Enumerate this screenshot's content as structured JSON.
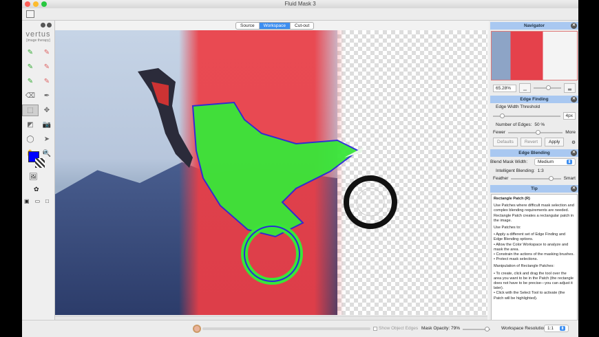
{
  "window": {
    "title": "Fluid Mask 3"
  },
  "logo": {
    "name": "vertus",
    "tagline": "[image therapy]"
  },
  "tabs": [
    {
      "label": "Source"
    },
    {
      "label": "Workspace",
      "active": true
    },
    {
      "label": "Cut-out"
    }
  ],
  "tools": [
    "brush-keep-icon",
    "brush-delete-icon",
    "brush-keep-medium-icon",
    "brush-delete-medium-icon",
    "brush-keep-large-icon",
    "brush-delete-large-icon",
    "eraser-icon",
    "pen-icon",
    "rectangle-patch-icon",
    "patch-local-icon",
    "color-picker-icon",
    "camera-icon",
    "lasso-icon",
    "select-arrow-icon",
    "hand-icon",
    "zoom-icon"
  ],
  "colors": {
    "foreground": "#0000ff",
    "accent": "#3d8ef0",
    "panel_header": "#a9c8f1",
    "mask_red": "#ec3e46",
    "edge_green": "#39e639",
    "edge_blue": "#2a2ad8"
  },
  "navigator": {
    "title": "Navigator",
    "zoom": "65.28%",
    "zoom_fraction": 0.45
  },
  "edge_finding": {
    "title": "Edge Finding",
    "threshold_label": "Edge Width Threshold",
    "threshold_value": "4px",
    "threshold_fraction": 0.1,
    "edges_label": "Number of Edges:",
    "edges_value": "50 %",
    "edges_fraction": 0.5,
    "fewer": "Fewer",
    "more": "More",
    "defaults": "Defaults",
    "revert": "Revert",
    "apply": "Apply"
  },
  "edge_blending": {
    "title": "Edge Blending",
    "mask_width_label": "Blend Mask Width:",
    "mask_width_value": "Medium",
    "intelligent_label": "Intelligent Blending:",
    "intelligent_value": "1:3",
    "feather": "Feather",
    "smart": "Smart",
    "blend_fraction": 0.75
  },
  "tip": {
    "title": "Tip",
    "heading": "Rectangle Patch (R)",
    "p1": "Use Patches where difficult mask selection and complex blending requirements are needed. Rectangle Patch creates a rectangular patch in the image.",
    "p2": "Use Patches to:",
    "b1": "• Apply a different set of Edge Finding and Edge Blending options.",
    "b2": "• Allow the Color Workspace to analyze and mask the area.",
    "b3": "• Constrain the actions of the masking brushes.",
    "b4": "• Protect mask selections.",
    "p3": "Manipulation of Rectangle Patches:",
    "b5": "• To create, click and drag the tool over the area you want to be in the Patch (the rectangle does not have to be precise—you can adjust it later).",
    "b6": "• Click with the Select Tool to activate (the Patch will be highlighted)."
  },
  "bottom": {
    "show_edges": "Show Object Edges",
    "mask_opacity": "Mask Opacity: 79%",
    "mask_opacity_fraction": 0.79,
    "workspace_res_label": "Workspace Resolution:",
    "workspace_res_value": "1:1"
  }
}
